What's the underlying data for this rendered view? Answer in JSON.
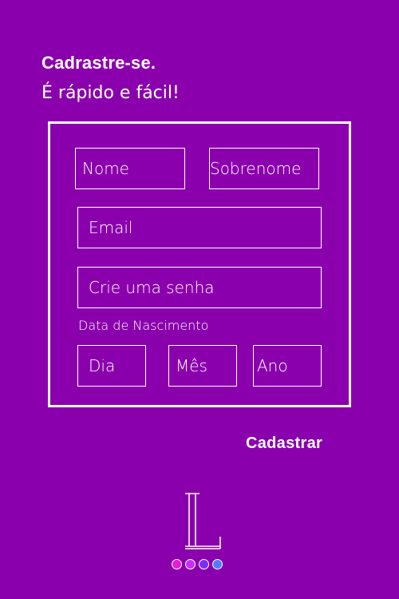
{
  "header": {
    "title": "Cadrastre-se.",
    "subtitle": "É rápido e fácil!"
  },
  "form": {
    "first_name": {
      "placeholder": "Nome",
      "value": ""
    },
    "last_name": {
      "placeholder": "Sobrenome",
      "value": ""
    },
    "email": {
      "placeholder": "Email",
      "value": ""
    },
    "password": {
      "placeholder": "Crie uma senha",
      "value": ""
    },
    "dob_label": "Data de Nascimento",
    "day": {
      "placeholder": "Dia",
      "value": ""
    },
    "month": {
      "placeholder": "Mês",
      "value": ""
    },
    "year": {
      "placeholder": "Ano",
      "value": ""
    },
    "submit_label": "Cadastrar"
  },
  "logo": {
    "icon": "book-l-logo-icon"
  },
  "pagination": {
    "dots": [
      {
        "color": "#e71cd9"
      },
      {
        "color": "#c72dff"
      },
      {
        "color": "#7a2cff"
      },
      {
        "color": "#4f7dff"
      }
    ]
  },
  "colors": {
    "background": "#8b00ad",
    "foreground": "#ffffff"
  }
}
